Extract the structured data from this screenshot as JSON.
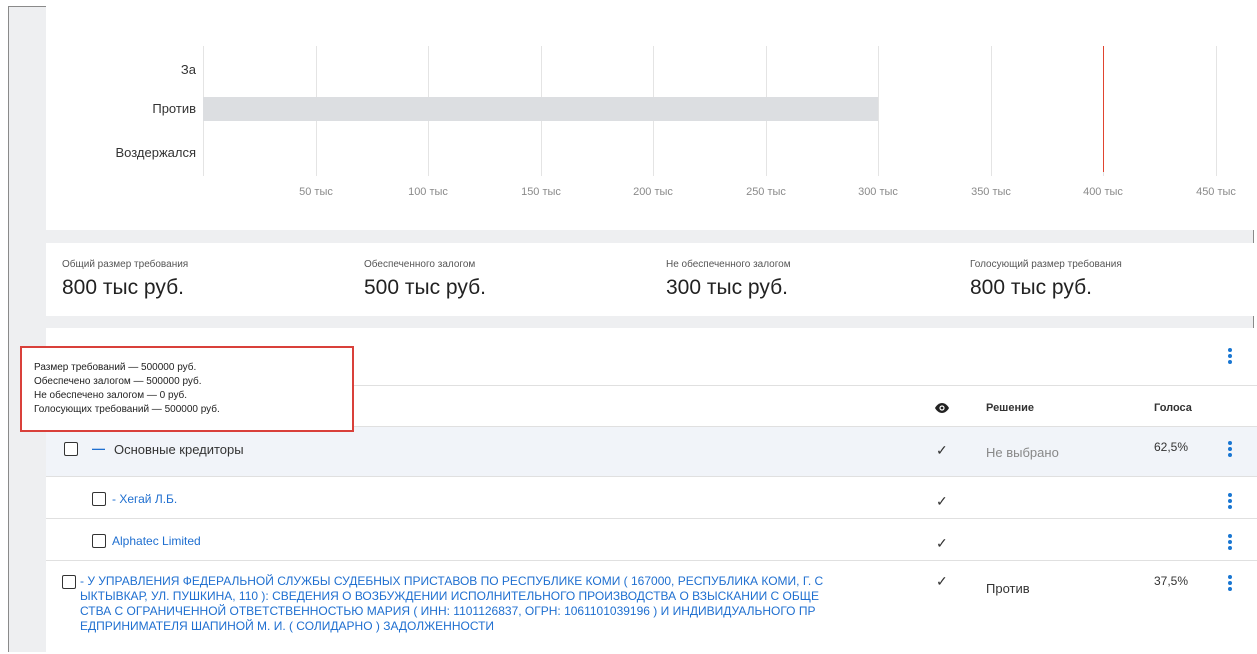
{
  "chart_data": {
    "type": "bar",
    "orientation": "horizontal",
    "categories": [
      "За",
      "Против",
      "Воздержался"
    ],
    "values": [
      0,
      300000,
      0
    ],
    "x_ticks": [
      "50 тыс",
      "100 тыс",
      "150 тыс",
      "200 тыс",
      "250 тыс",
      "300 тыс",
      "350 тыс",
      "400 тыс",
      "450 тыс"
    ],
    "xlim": [
      0,
      450000
    ],
    "threshold": 400000,
    "bar_color": "#dcdee1",
    "threshold_color": "#e0442f",
    "grid": true
  },
  "summary": [
    {
      "label": "Общий размер требования",
      "value": "800 тыс руб."
    },
    {
      "label": "Обеспеченного залогом",
      "value": "500 тыс руб."
    },
    {
      "label": "Не обеспеченного залогом",
      "value": "300 тыс руб."
    },
    {
      "label": "Голосующий размер требования",
      "value": "800 тыс руб."
    }
  ],
  "tooltip": {
    "lines": [
      "Размер требований — 500000 руб.",
      "Обеспечено залогом — 500000 руб.",
      "Не обеспечено залогом — 0 руб.",
      "Голосующих требований — 500000 руб."
    ]
  },
  "table": {
    "headers": {
      "decision": "Решение",
      "votes": "Голоса"
    },
    "eye_icon": "eye-icon",
    "rows": [
      {
        "name": "Основные кредиторы",
        "collapse": "—",
        "check": "✓",
        "decision": "Не выбрано",
        "votes": "62,5%"
      },
      {
        "name": "- Хегай Л.Б.",
        "check": "✓",
        "decision": "",
        "votes": ""
      },
      {
        "name": "Alphatec Limited",
        "check": "✓",
        "decision": "",
        "votes": ""
      },
      {
        "name_lines": [
          "- У УПРАВЛЕНИЯ ФЕДЕРАЛЬНОЙ СЛУЖБЫ СУДЕБНЫХ ПРИСТАВОВ ПО РЕСПУБЛИКЕ КОМИ ( 167000, РЕСПУБЛИКА КОМИ, Г. С",
          "ЫКТЫВКАР, УЛ. ПУШКИНА, 110 ): СВЕДЕНИЯ О ВОЗБУЖДЕНИИ ИСПОЛНИТЕЛЬНОГО ПРОИЗВОДСТВА О ВЗЫСКАНИИ С ОБЩЕ",
          "СТВА С ОГРАНИЧЕННОЙ ОТВЕТСТВЕННОСТЬЮ МАРИЯ ( ИНН: 1101126837, ОГРН: 1061101039196 ) И ИНДИВИДУАЛЬНОГО ПР",
          "ЕДПРИНИМАТЕЛЯ ШАПИНОЙ М. И. ( СОЛИДАРНО ) ЗАДОЛЖЕННОСТИ"
        ],
        "check": "✓",
        "decision": "Против",
        "votes": "37,5%"
      }
    ]
  }
}
